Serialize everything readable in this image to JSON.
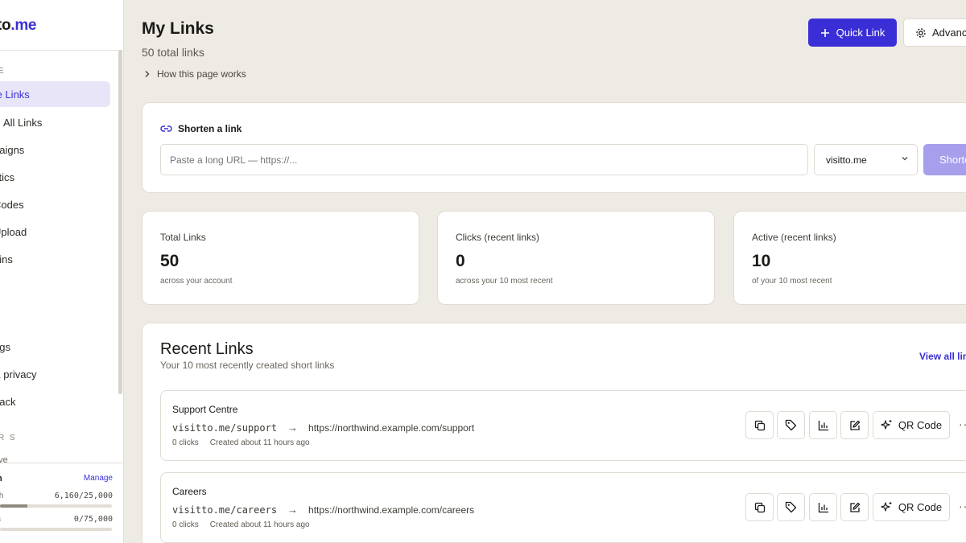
{
  "sidebar": {
    "brand_text": "to",
    "brand_accent": ".me",
    "section_top": "E",
    "items": [
      {
        "label": "te Links",
        "active": true
      },
      {
        "label": "All Links"
      },
      {
        "label": "paigns"
      },
      {
        "label": "ytics"
      },
      {
        "label": "Codes"
      },
      {
        "label": "Upload"
      },
      {
        "label": "ains"
      },
      {
        "label": "g"
      },
      {
        "label": "ngs"
      },
      {
        "label": "& privacy"
      },
      {
        "label": "back"
      }
    ],
    "section_bottom": "R S",
    "partial_item": "ove"
  },
  "plan": {
    "title": "n",
    "manage": "Manage",
    "usage": [
      {
        "label": "th",
        "value": "6,160/25,000",
        "fraction": 0.2464
      },
      {
        "label": "s",
        "value": "0/75,000",
        "fraction": 0
      }
    ]
  },
  "header": {
    "title": "My Links",
    "subtitle": "50 total links",
    "how_link": "How this page works",
    "quick_link": "Quick Link",
    "advanced": "Advanced"
  },
  "shorten": {
    "title": "Shorten a link",
    "placeholder": "Paste a long URL — https://...",
    "domain": "visitto.me",
    "button": "Shorten"
  },
  "stats": [
    {
      "label": "Total Links",
      "value": "50",
      "sub": "across your account"
    },
    {
      "label": "Clicks (recent links)",
      "value": "0",
      "sub": "across your 10 most recent"
    },
    {
      "label": "Active (recent links)",
      "value": "10",
      "sub": "of your 10 most recent"
    }
  ],
  "recent": {
    "title": "Recent Links",
    "subtitle": "Your 10 most recently created short links",
    "view_all": "View all links",
    "qr_label": "QR Code",
    "links": [
      {
        "name": "Support Centre",
        "short": "visitto.me/support",
        "arrow": "→",
        "dest": "https://northwind.example.com/support",
        "clicks": "0 clicks",
        "created": "Created about 11 hours ago"
      },
      {
        "name": "Careers",
        "short": "visitto.me/careers",
        "arrow": "→",
        "dest": "https://northwind.example.com/careers",
        "clicks": "0 clicks",
        "created": "Created about 11 hours ago"
      }
    ]
  },
  "colors": {
    "accent": "#3a2fd6",
    "background": "#eeebe4",
    "active_nav": "#e7e5f7",
    "disabled_button": "#a6a0ec"
  }
}
